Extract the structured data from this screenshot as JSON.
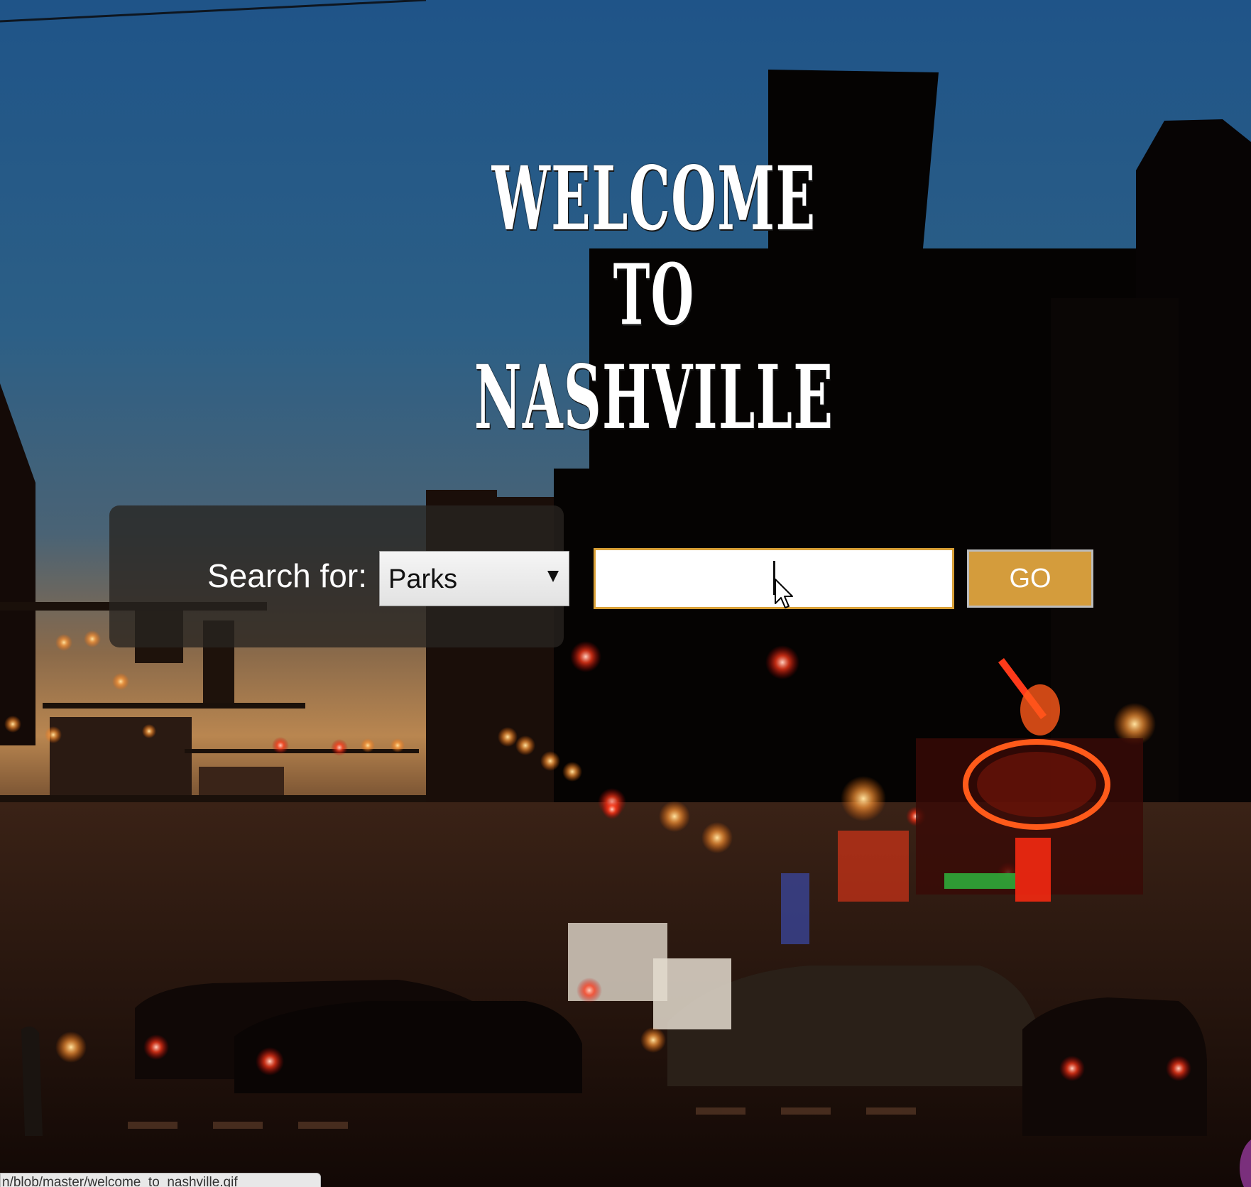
{
  "hero": {
    "title_line_1": "Welcome",
    "title_line_2": "to",
    "title_line_3": "Nashville"
  },
  "search": {
    "label": "Search for:",
    "category_selected": "Parks",
    "input_value": "",
    "go_label": "GO"
  },
  "status_bar": {
    "url": "n/blob/master/welcome_to_nashville.gif"
  },
  "colors": {
    "accent": "#d49c3c",
    "input_border": "#d9a037",
    "title": "#ffffff"
  },
  "background": {
    "description_icon": "city-street-night-photo"
  }
}
